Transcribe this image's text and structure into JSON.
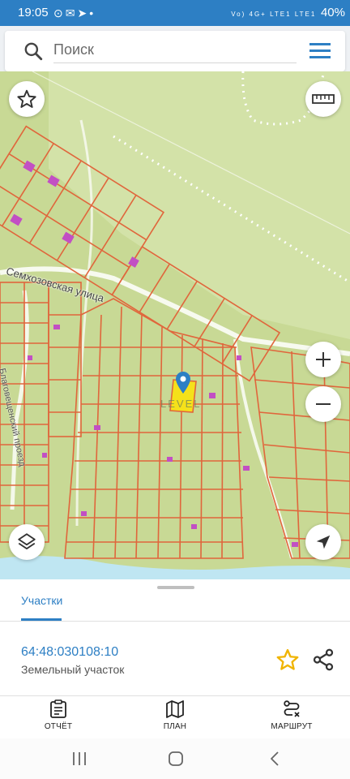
{
  "status_bar": {
    "time": "19:05",
    "battery": "40%",
    "network": "Vo) 4G+ LTE1 LTE1"
  },
  "search": {
    "placeholder": "Поиск"
  },
  "map": {
    "street_name": "Семхозовская улица",
    "street_name_2": "Благовещенский проезд",
    "marker_watermark": "LEVEL"
  },
  "sheet": {
    "tab_label": "Участки",
    "cadastral_number": "64:48:030108:10",
    "parcel_type": "Земельный участок"
  },
  "nav": {
    "report": "ОТЧЁТ",
    "plan": "ПЛАН",
    "route": "МАРШРУТ"
  },
  "colors": {
    "accent": "#2d7fc4",
    "map_bg": "#c8d995",
    "parcel_line": "#e0663c",
    "building": "#c24fc4",
    "marker": "#2d7fc4",
    "highlight": "#f5e11a",
    "fav_star": "#f0b400"
  },
  "icons": [
    "search-icon",
    "menu-icon",
    "star-outline-icon",
    "ruler-icon",
    "plus-icon",
    "minus-icon",
    "layers-icon",
    "navigation-arrow-icon",
    "star-icon",
    "share-icon",
    "report-icon",
    "map-icon",
    "route-icon",
    "recents-icon",
    "home-icon",
    "back-icon"
  ]
}
